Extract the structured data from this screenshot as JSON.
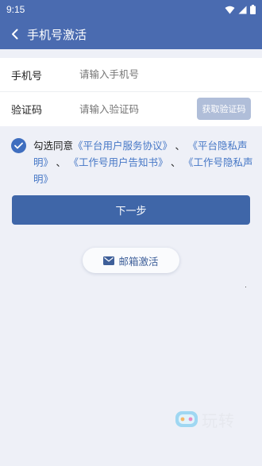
{
  "status_bar": {
    "time": "9:15"
  },
  "header": {
    "title": "手机号激活"
  },
  "form": {
    "phone": {
      "label": "手机号",
      "placeholder": "请输入手机号"
    },
    "code": {
      "label": "验证码",
      "placeholder": "请输入验证码",
      "button": "获取验证码"
    }
  },
  "agreement": {
    "checked": true,
    "prefix": "勾选同意",
    "links": [
      "《平台用户服务协议》",
      "《平台隐私声明》",
      "《工作号用户告知书》",
      "《工作号隐私声明》"
    ],
    "separator": "、"
  },
  "next_button": "下一步",
  "email_button": "邮箱激活",
  "watermark": "玩转",
  "colors": {
    "primary": "#4a6bb0",
    "button": "#3f66a8",
    "link": "#4677c6",
    "background": "#eef0f7"
  }
}
